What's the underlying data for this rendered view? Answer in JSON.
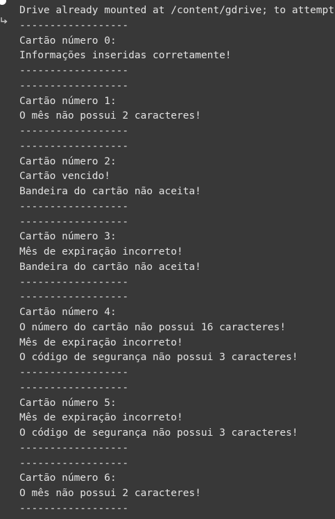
{
  "output": {
    "lines": [
      "Drive already mounted at /content/gdrive; to attempt to forcibly remount, call drive.mount(\"/content/gdrive\", force_remount=True).",
      "------------------",
      "Cartão número 0:",
      "Informações inseridas corretamente!",
      "------------------",
      "------------------",
      "Cartão número 1:",
      "O mês não possui 2 caracteres!",
      "------------------",
      "------------------",
      "Cartão número 2:",
      "Cartão vencido!",
      "Bandeira do cartão não aceita!",
      "------------------",
      "------------------",
      "Cartão número 3:",
      "Mês de expiração incorreto!",
      "Bandeira do cartão não aceita!",
      "------------------",
      "------------------",
      "Cartão número 4:",
      "O número do cartão não possui 16 caracteres!",
      "Mês de expiração incorreto!",
      "O código de segurança não possui 3 caracteres!",
      "------------------",
      "------------------",
      "Cartão número 5:",
      "Mês de expiração incorreto!",
      "O código de segurança não possui 3 caracteres!",
      "------------------",
      "------------------",
      "Cartão número 6:",
      "O mês não possui 2 caracteres!",
      "------------------"
    ]
  },
  "icons": {
    "run_indicator": "run-indicator-dot",
    "output": "output-redirect-icon"
  },
  "colors": {
    "background": "#383838",
    "text": "#e3e3e3",
    "indicator": "#ffffff"
  }
}
